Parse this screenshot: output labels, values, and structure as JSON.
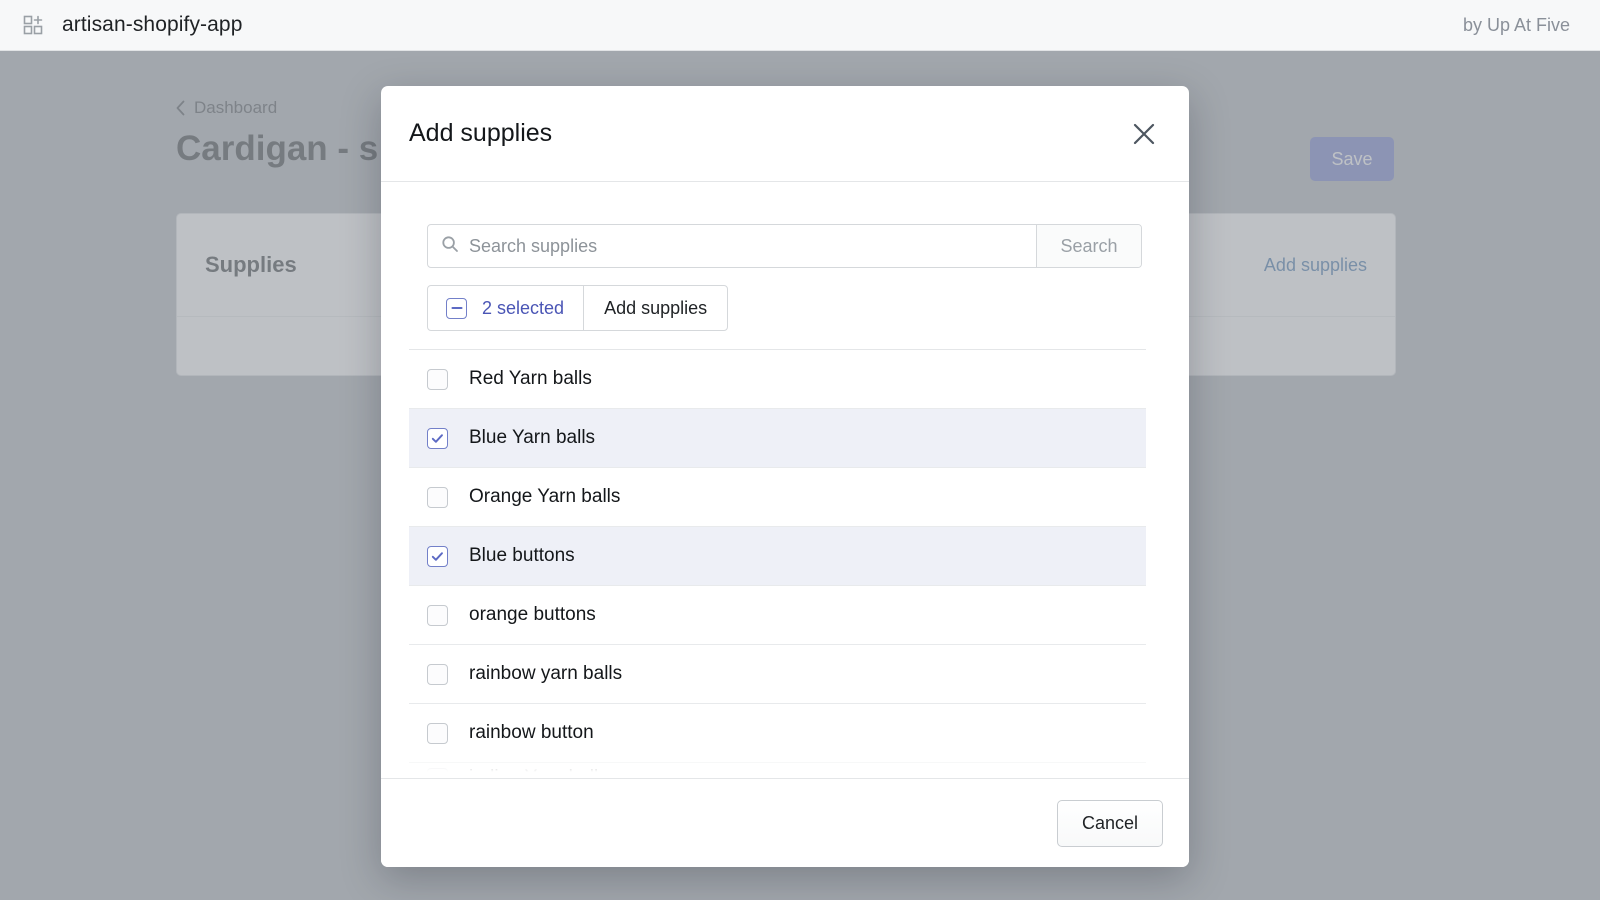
{
  "topbar": {
    "app_icon": "add-app-grid-icon",
    "app_name": "artisan-shopify-app",
    "byline": "by Up At Five"
  },
  "background_page": {
    "breadcrumb": "Dashboard",
    "back_icon": "chevron-left-icon",
    "title": "Cardigan - s",
    "save_label": "Save",
    "card": {
      "title": "Supplies",
      "action_label": "Add supplies"
    }
  },
  "modal": {
    "title": "Add supplies",
    "close_icon": "close-icon",
    "search": {
      "icon": "search-icon",
      "placeholder": "Search supplies",
      "value": "",
      "button_label": "Search"
    },
    "bulk": {
      "checkbox_state": "indeterminate",
      "count_label": "2 selected",
      "action_label": "Add supplies"
    },
    "items": [
      {
        "label": "Red Yarn balls",
        "checked": false,
        "clipped": false
      },
      {
        "label": "Blue Yarn balls",
        "checked": true,
        "clipped": false
      },
      {
        "label": "Orange Yarn balls",
        "checked": false,
        "clipped": false
      },
      {
        "label": "Blue buttons",
        "checked": true,
        "clipped": false
      },
      {
        "label": "orange buttons",
        "checked": false,
        "clipped": false
      },
      {
        "label": "rainbow yarn balls",
        "checked": false,
        "clipped": false
      },
      {
        "label": "rainbow button",
        "checked": false,
        "clipped": false
      },
      {
        "label": "indigo Yarn balls",
        "checked": false,
        "clipped": true
      }
    ],
    "footer": {
      "cancel_label": "Cancel"
    }
  },
  "colors": {
    "accent_indigo": "#5c6ac4",
    "link_blue": "#1e5a9c",
    "selected_row": "#eef0f7",
    "scrim": "#a2a7ad"
  }
}
